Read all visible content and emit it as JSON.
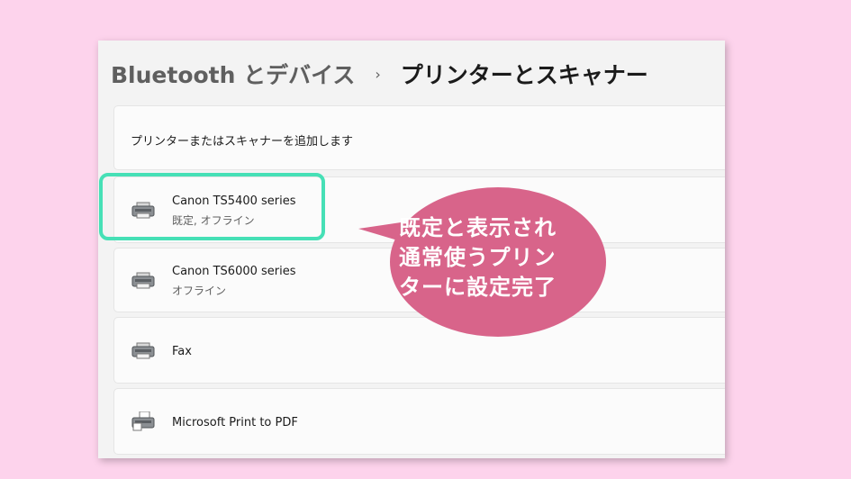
{
  "breadcrumb": {
    "parent": "Bluetooth とデバイス",
    "separator": "›",
    "current": "プリンターとスキャナー"
  },
  "add_printer": {
    "label": "プリンターまたはスキャナーを追加します"
  },
  "printers": [
    {
      "name": "Canon TS5400 series",
      "status": "既定, オフライン",
      "icon": "printer-icon"
    },
    {
      "name": "Canon TS6000 series",
      "status": "オフライン",
      "icon": "printer-icon"
    },
    {
      "name": "Fax",
      "status": "",
      "icon": "printer-icon"
    },
    {
      "name": "Microsoft Print to PDF",
      "status": "",
      "icon": "pdf-printer-icon"
    }
  ],
  "annotation": {
    "lines": [
      "既定と表示され",
      "通常使うプリン",
      "ターに設定完了"
    ]
  },
  "colors": {
    "background": "#fdd3ec",
    "highlight_border": "#46e0b6",
    "callout_fill": "#d8648a"
  }
}
